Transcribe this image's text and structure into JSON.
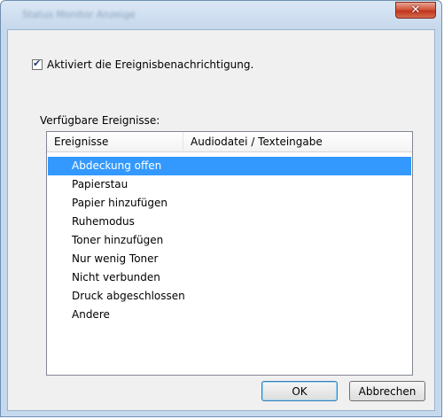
{
  "window": {
    "title": "Status Monitor Anzeige",
    "close_glyph": "✕"
  },
  "notification": {
    "checked": true,
    "label": "Aktiviert die Ereignisbenachrichtigung."
  },
  "events_group": {
    "label": "Verfügbare Ereignisse:"
  },
  "events_list": {
    "columns": [
      "Ereignisse",
      "Audiodatei / Texteingabe"
    ],
    "rows": [
      {
        "event": "Abdeckung offen",
        "selected": true
      },
      {
        "event": "Papierstau",
        "selected": false
      },
      {
        "event": "Papier hinzufügen",
        "selected": false
      },
      {
        "event": "Ruhemodus",
        "selected": false
      },
      {
        "event": "Toner hinzufügen",
        "selected": false
      },
      {
        "event": "Nur wenig Toner",
        "selected": false
      },
      {
        "event": "Nicht verbunden",
        "selected": false
      },
      {
        "event": "Druck abgeschlossen",
        "selected": false
      },
      {
        "event": "Andere",
        "selected": false
      }
    ],
    "selection_color": "#3399ff"
  },
  "buttons": {
    "ok_label": "OK",
    "cancel_label": "Abbrechen"
  },
  "icons": {
    "close": "close-icon",
    "checkbox": "checkmark-icon"
  }
}
